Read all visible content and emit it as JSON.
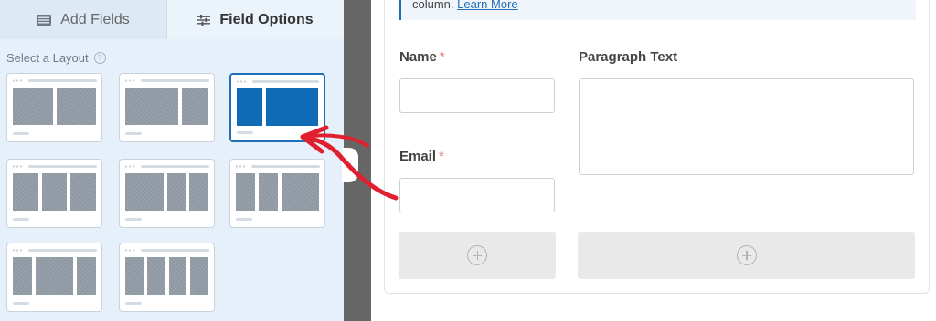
{
  "tabs": {
    "add_fields": "Add Fields",
    "field_options": "Field Options"
  },
  "layout_section": {
    "label": "Select a Layout",
    "help": "?",
    "options": [
      {
        "columns": [
          50,
          50
        ],
        "selected": false
      },
      {
        "columns": [
          67,
          33
        ],
        "selected": false
      },
      {
        "columns": [
          33,
          67
        ],
        "selected": true
      },
      {
        "columns": [
          33,
          33,
          33
        ],
        "selected": false
      },
      {
        "columns": [
          50,
          25,
          25
        ],
        "selected": false
      },
      {
        "columns": [
          25,
          25,
          50
        ],
        "selected": false
      },
      {
        "columns": [
          25,
          50,
          25
        ],
        "selected": false
      },
      {
        "columns": [
          25,
          25,
          25,
          25
        ],
        "selected": false
      }
    ]
  },
  "notice": {
    "text": "column.",
    "link": "Learn More"
  },
  "form": {
    "name_label": "Name",
    "email_label": "Email",
    "paragraph_label": "Paragraph Text",
    "required_mark": "*"
  },
  "colors": {
    "accent": "#1e6fb8",
    "selected_col": "#0f6bb5",
    "arrow": "#e0202e",
    "panel_bg": "#e6f0fa"
  }
}
